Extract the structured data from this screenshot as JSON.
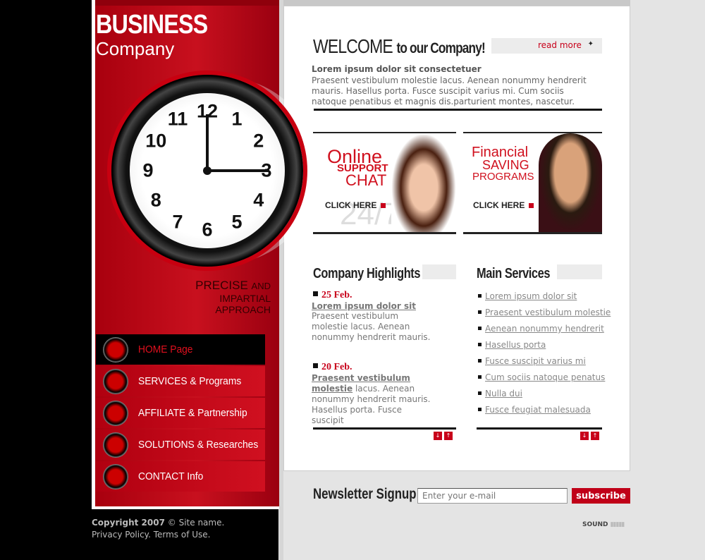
{
  "logo": {
    "line1": "BUSINESS",
    "line2": "Company"
  },
  "tagline": {
    "line1": "PRECISE",
    "line1b": "AND",
    "line2": "IMPARTIAL",
    "line3": "APPROACH"
  },
  "clock": {
    "numbers": [
      "12",
      "1",
      "2",
      "3",
      "4",
      "5",
      "6",
      "7",
      "8",
      "9",
      "10",
      "11"
    ],
    "time": "12:15"
  },
  "nav": [
    {
      "label": "HOME Page",
      "icon": "arrow-circle-icon",
      "active": true
    },
    {
      "label": "SERVICES & Programs",
      "icon": "wrench-circle-icon"
    },
    {
      "label": "AFFILIATE & Partnership",
      "icon": "handshake-circle-icon"
    },
    {
      "label": "SOLUTIONS & Researches",
      "icon": "check-circle-icon"
    },
    {
      "label": "CONTACT Info",
      "icon": "pen-circle-icon"
    }
  ],
  "footer": {
    "copyright_bold": "Copyright 2007",
    "copyright_rest": "© Site name.",
    "links": "Privacy Policy. Terms of Use."
  },
  "welcome": {
    "big": "WELCOME",
    "small": "to our Company!",
    "read_more": "read more",
    "heading": "Lorem ipsum dolor sit consectetuer",
    "text": "Praesent vestibulum molestie lacus. Aenean nonummy hendrerit mauris. Hasellus porta. Fusce suscipit varius mi. Cum sociis natoque penatibus et magnis dis.parturient montes, nascetur."
  },
  "banners": [
    {
      "l1": "Online",
      "l2": "SUPPORT",
      "l3": "CHAT",
      "bg": "24/7",
      "cta": "CLICK HERE"
    },
    {
      "l1": "Financial",
      "l2": "SAVING",
      "l3": "PROGRAMS",
      "cta": "CLICK HERE"
    }
  ],
  "highlights": {
    "title": "Company Highlights",
    "items": [
      {
        "date": "25 Feb.",
        "link": "Lorem ipsum dolor sit",
        "text": "Praesent vestibulum molestie lacus. Aenean nonummy hendrerit mauris."
      },
      {
        "date": "20 Feb.",
        "link": "Praesent vestibulum molestie",
        "text": "lacus. Aenean nonummy hendrerit mauris. Hasellus porta. Fusce suscipit"
      }
    ]
  },
  "services": {
    "title": "Main Services",
    "items": [
      "Lorem ipsum dolor sit",
      "Praesent vestibulum molestie",
      "Aenean nonummy hendrerit",
      "Hasellus porta",
      "Fusce suscipit varius mi",
      "Cum sociis natoque penatus",
      "Nulla dui",
      "Fusce feugiat malesuada"
    ]
  },
  "scroll": {
    "down": "↓",
    "up": "↑"
  },
  "newsletter": {
    "label": "Newsletter Signup:",
    "placeholder": "Enter your e-mail",
    "button": "subscribe"
  },
  "sound": {
    "label": "SOUND"
  },
  "colors": {
    "accent": "#c8001a",
    "panel": "#b00010"
  }
}
